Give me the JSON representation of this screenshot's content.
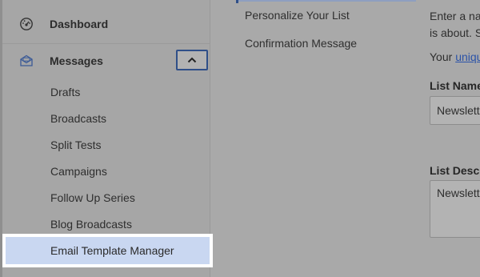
{
  "sidebar": {
    "dashboard": {
      "label": "Dashboard",
      "icon": "dashboard-gauge-icon"
    },
    "messages": {
      "label": "Messages",
      "icon": "envelope-icon",
      "toggle_icon": "chevron-up-icon"
    },
    "submenu": [
      "Drafts",
      "Broadcasts",
      "Split Tests",
      "Campaigns",
      "Follow Up Series",
      "Blog Broadcasts",
      "Email Template Manager"
    ],
    "active_item": "Email Template Manager"
  },
  "middle_nav": {
    "items": [
      "Personalize Your List",
      "Confirmation Message"
    ]
  },
  "right_panel": {
    "intro_line1": "Enter a na",
    "intro_line2": "is about. S",
    "your_text": "Your ",
    "your_link": "uniqu",
    "list_name_label": "List Name",
    "list_name_value": "Newslett",
    "list_desc_label": "List Descr",
    "list_desc_value": "Newslett"
  },
  "colors": {
    "accent": "#2f4f88",
    "highlight_bg": "#c9d7f1",
    "link": "#2a52a8"
  }
}
